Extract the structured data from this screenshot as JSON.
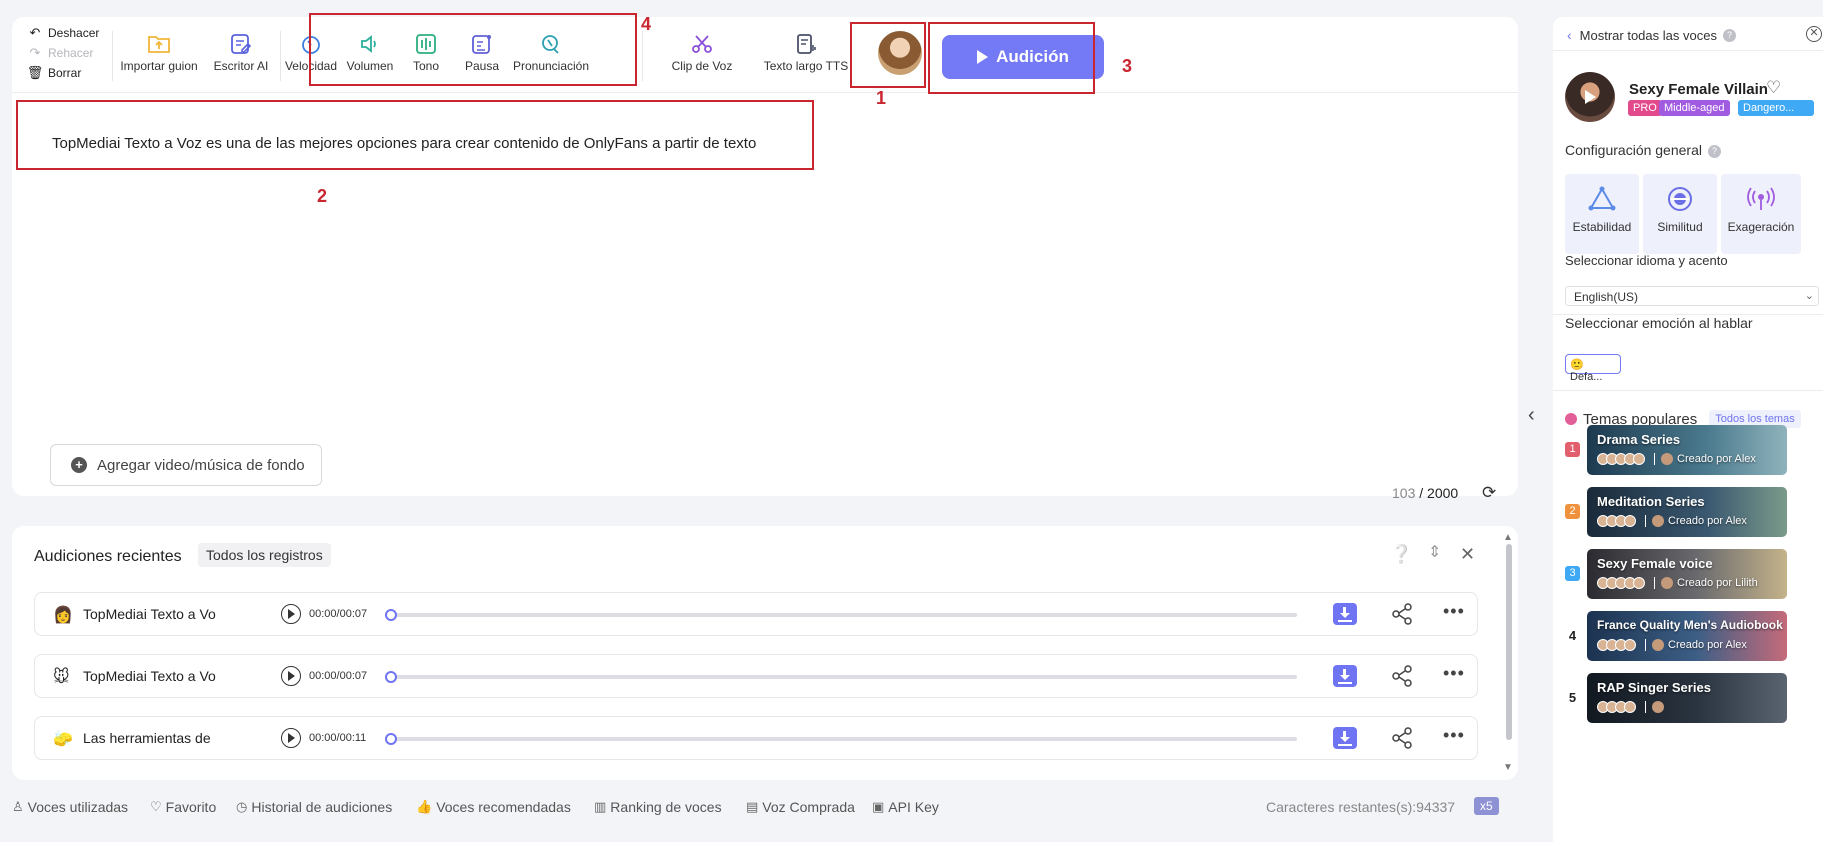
{
  "toolbar": {
    "undo": "Deshacer",
    "redo": "Rehacer",
    "clear": "Borrar",
    "import_script": "Importar guion",
    "ai_writer": "Escritor AI",
    "speed": "Velocidad",
    "volume": "Volumen",
    "tone": "Tono",
    "pause": "Pausa",
    "pronunciation": "Pronunciación",
    "voice_clip": "Clip de Voz",
    "long_tts": "Texto largo TTS",
    "audition": "Audición"
  },
  "annotations": {
    "n1": "1",
    "n2": "2",
    "n3": "3",
    "n4a": "4",
    "n4b": "4"
  },
  "editor": {
    "text": "TopMediai Texto a Voz es una de las mejores opciones para crear contenido de OnlyFans a partir de texto",
    "add_background": "Agregar video/música de fondo",
    "char_used": "103",
    "char_max": "/ 2000"
  },
  "recent": {
    "title": "Audiciones recientes",
    "all_records": "Todos los registros",
    "rows": [
      {
        "emoji": "👩",
        "name": "TopMediai Texto a Vo",
        "time": "00:00/00:07"
      },
      {
        "emoji": "🐭",
        "name": "TopMediai Texto a Vo",
        "time": "00:00/00:07"
      },
      {
        "emoji": "🧽",
        "name": "Las herramientas de",
        "time": "00:00/00:11"
      }
    ]
  },
  "footer": {
    "used_voices": "Voces utilizadas",
    "favorite": "Favorito",
    "history": "Historial de audiciones",
    "recommended": "Voces recomendadas",
    "ranking": "Ranking de voces",
    "purchased": "Voz Comprada",
    "api_key": "API Key",
    "remaining": "Caracteres restantes(s):94337",
    "multiplier": "x5"
  },
  "right_panel": {
    "back": "Mostrar todas las voces",
    "voice_name": "Sexy Female Villain",
    "tags": [
      {
        "label": "PRO",
        "color": "#e24a8b"
      },
      {
        "label": "Middle-aged",
        "color": "#a15be0"
      },
      {
        "label": "Dangero...",
        "color": "#3fa9f5"
      }
    ],
    "general_config": "Configuración general",
    "settings": [
      "Estabilidad",
      "Similitud",
      "Exageración"
    ],
    "lang_label": "Seleccionar idioma y acento",
    "lang_value": "English(US)",
    "emotion_label": "Seleccionar emoción al hablar",
    "emotion_value": "Defa...",
    "topics_title": "Temas populares",
    "topics_all": "Todos los temas",
    "topics": [
      {
        "rank": "1",
        "title": "Drama Series",
        "by": "Creado por Alex",
        "rank_color": "#e25f6e"
      },
      {
        "rank": "2",
        "title": "Meditation Series",
        "by": "Creado por Alex",
        "rank_color": "#f0913d"
      },
      {
        "rank": "3",
        "title": "Sexy Female voice",
        "by": "Creado por Lilith",
        "rank_color": "#3fa9f5"
      },
      {
        "rank": "4",
        "title": "France Quality Men's Audiobook",
        "by": "Creado por Alex",
        "rank_color": ""
      },
      {
        "rank": "5",
        "title": "RAP Singer Series",
        "by": "",
        "rank_color": ""
      }
    ]
  },
  "colors": {
    "accent": "#7479f5",
    "annotation": "#c9262f"
  }
}
